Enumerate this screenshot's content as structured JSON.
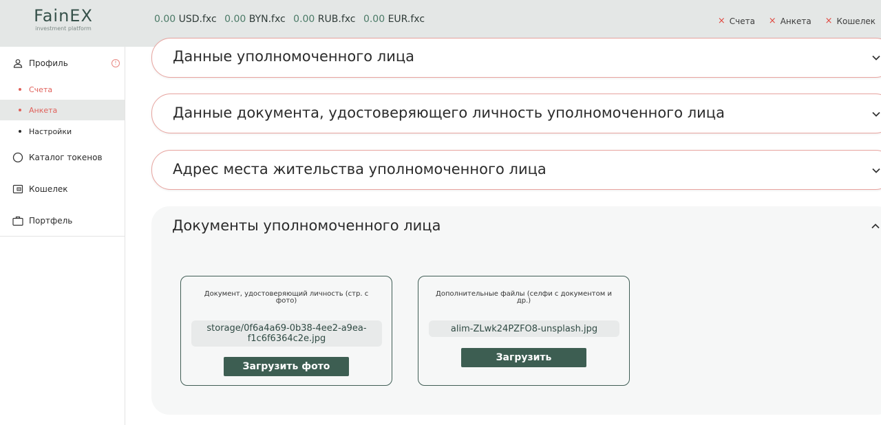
{
  "header": {
    "logo_name": "FainEX",
    "logo_sub": "investment platform",
    "balances": [
      {
        "amount": "0.00",
        "currency": "USD.fxc"
      },
      {
        "amount": "0.00",
        "currency": "BYN.fxc"
      },
      {
        "amount": "0.00",
        "currency": "RUB.fxc"
      },
      {
        "amount": "0.00",
        "currency": "EUR.fxc"
      }
    ],
    "status_links": [
      {
        "icon": "×",
        "label": "Счета"
      },
      {
        "icon": "×",
        "label": "Анкета"
      },
      {
        "icon": "×",
        "label": "Кошелек"
      }
    ]
  },
  "sidebar": {
    "profile": {
      "label": "Профиль",
      "warning": "!"
    },
    "sub_items": [
      {
        "label": "Счета",
        "state": "error"
      },
      {
        "label": "Анкета",
        "state": "error-active"
      },
      {
        "label": "Настройки",
        "state": "normal"
      }
    ],
    "items": [
      {
        "label": "Каталог токенов",
        "icon": "circle-icon"
      },
      {
        "label": "Кошелек",
        "icon": "wallet-icon"
      },
      {
        "label": "Портфель",
        "icon": "briefcase-icon"
      }
    ]
  },
  "sections": [
    {
      "title": "Данные уполномоченного лица",
      "state": "collapsed"
    },
    {
      "title": "Данные документа, удостоверяющего личность уполномоченного лица",
      "state": "collapsed"
    },
    {
      "title": "Адрес места жительства уполномоченного лица",
      "state": "collapsed"
    }
  ],
  "documents_panel": {
    "title": "Документы уполномоченного лица",
    "state": "expanded",
    "cards": [
      {
        "label": "Документ, удостоверяющий личность (стр. с фото)",
        "file": "storage/0f6a4a69-0b38-4ee2-a9ea-f1c6f6364c2e.jpg",
        "button": "Загрузить фото"
      },
      {
        "label": "Дополнительные файлы (селфи с документом и др.)",
        "file": "alim-ZLwk24PZFO8-unsplash.jpg",
        "button": "Загрузить"
      }
    ]
  },
  "colors": {
    "accent": "#3d5e52",
    "error": "#e0483f",
    "border_warning": "#e8a49f"
  }
}
